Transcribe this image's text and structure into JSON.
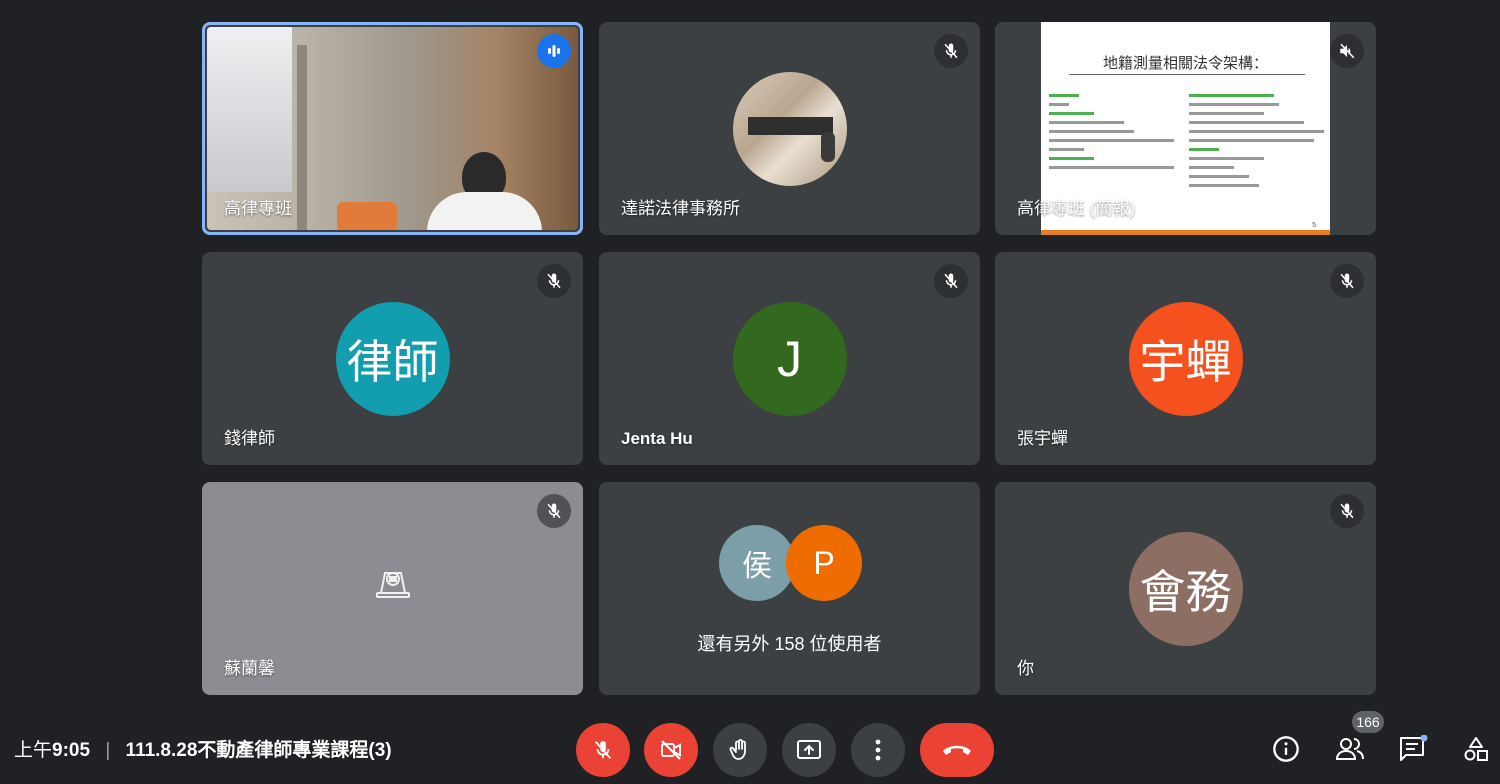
{
  "tiles": [
    {
      "name": "高律專班"
    },
    {
      "name": "達諾法律事務所"
    },
    {
      "name": "高律專班 (簡報)"
    },
    {
      "name": "錢律師",
      "avatar_text": "律師",
      "avatar_color": "#129eaf"
    },
    {
      "name": "Jenta Hu",
      "avatar_text": "J",
      "avatar_color": "#33691e"
    },
    {
      "name": "張宇蟬",
      "avatar_text": "宇蟬",
      "avatar_color": "#f4511e"
    },
    {
      "name": "蘇蘭馨"
    },
    {
      "others_text": "還有另外 158 位使用者",
      "avatar1_text": "侯",
      "avatar2_text": "P",
      "avatar1_color": "#7b9ea8",
      "avatar2_color": "#ef6c00"
    },
    {
      "name": "你",
      "avatar_text": "會務",
      "avatar_color": "#8d6e63"
    }
  ],
  "slide": {
    "title": "地籍測量相關法令架構：",
    "page": "5"
  },
  "meeting": {
    "time_prefix": "上午",
    "time": "9:05",
    "separator": "|",
    "title": "111.8.28不動產律師專業課程(3)"
  },
  "participants_count": "166",
  "icons": [
    "microphone-active-icon",
    "mic-off-icon",
    "volume-off-icon",
    "camera-off-icon",
    "video-off-icon",
    "raise-hand-icon",
    "present-screen-icon",
    "more-options-icon",
    "hang-up-icon",
    "info-icon",
    "people-icon",
    "chat-icon",
    "activities-icon"
  ]
}
